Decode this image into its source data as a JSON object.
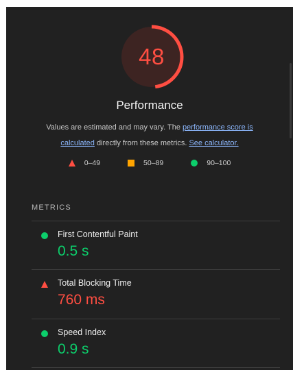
{
  "gauge": {
    "score": "48",
    "fraction": 0.48,
    "color": "#ff4e42",
    "label": "Performance"
  },
  "description": {
    "text_before": "Values are estimated and may vary. The ",
    "link1": "performance score is calculated",
    "text_middle": " directly from these metrics. ",
    "link2": "See calculator."
  },
  "legend": [
    {
      "icon": "triangle-icon",
      "range": "0–49",
      "color": "#ff4e42"
    },
    {
      "icon": "square-icon",
      "range": "50–89",
      "color": "#ffa400"
    },
    {
      "icon": "circle-icon",
      "range": "90–100",
      "color": "#0cce6b"
    }
  ],
  "metrics_heading": "METRICS",
  "metrics": [
    {
      "name": "First Contentful Paint",
      "value": "0.5 s",
      "status": "good"
    },
    {
      "name": "Total Blocking Time",
      "value": "760 ms",
      "status": "bad"
    },
    {
      "name": "Speed Index",
      "value": "0.9 s",
      "status": "good"
    }
  ]
}
